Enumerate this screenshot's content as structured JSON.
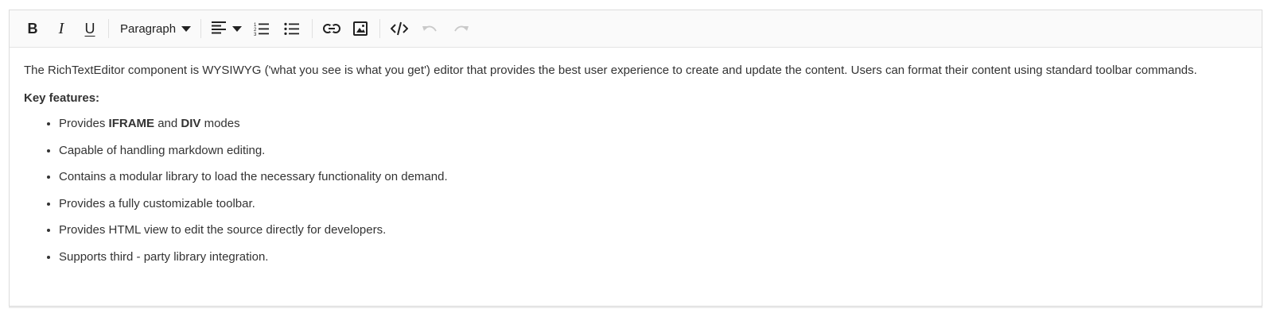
{
  "toolbar": {
    "bold_label": "B",
    "italic_label": "I",
    "underline_label": "U",
    "format_value": "Paragraph",
    "icons": [
      "bold-icon",
      "italic-icon",
      "underline-icon",
      "format-dropdown",
      "align-left-icon",
      "ordered-list-icon",
      "unordered-list-icon",
      "link-icon",
      "image-icon",
      "source-code-icon",
      "undo-icon",
      "redo-icon"
    ],
    "undo_disabled": true,
    "redo_disabled": true
  },
  "content": {
    "intro": "The RichTextEditor component is WYSIWYG ('what you see is what you get') editor that provides the best user experience to create and update the content. Users can format their content using standard toolbar commands.",
    "key_features_label": "Key features:",
    "features": [
      {
        "pre": "Provides ",
        "b1": "IFRAME",
        "mid": " and ",
        "b2": "DIV",
        "post": " modes"
      },
      {
        "text": "Capable of handling markdown editing."
      },
      {
        "text": "Contains a modular library to load the necessary functionality on demand."
      },
      {
        "text": "Provides a fully customizable toolbar."
      },
      {
        "text": "Provides HTML view to edit the source directly for developers."
      },
      {
        "text": "Supports third - party library integration."
      }
    ]
  },
  "colors": {
    "toolbar_bg": "#fafafa",
    "border": "#dcdcdc",
    "text": "#333333",
    "icon": "#212121",
    "disabled_icon": "#c9c9c9"
  }
}
